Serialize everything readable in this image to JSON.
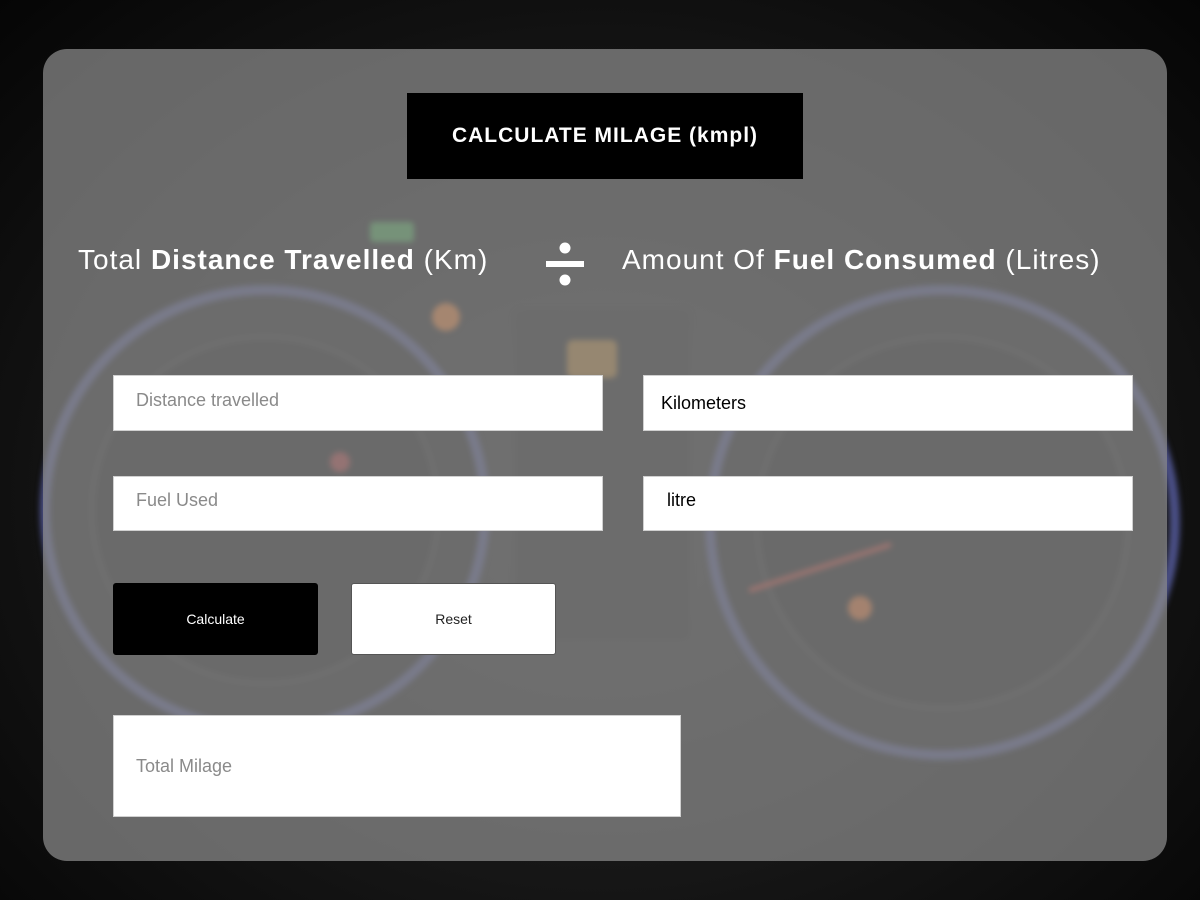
{
  "header": {
    "title": "CALCULATE MILAGE (kmpl)"
  },
  "formula": {
    "left_prefix": "Total ",
    "left_bold": "Distance Travelled",
    "left_suffix": " (Km)",
    "operator_icon": "divide-icon",
    "right_prefix": "Amount Of ",
    "right_bold": "Fuel Consumed",
    "right_suffix": " (Litres)"
  },
  "form": {
    "distance_placeholder": "Distance travelled",
    "distance_value": "",
    "distance_unit": "Kilometers",
    "fuel_placeholder": "Fuel Used",
    "fuel_value": "",
    "fuel_unit": "litre",
    "calculate_label": "Calculate",
    "reset_label": "Reset",
    "total_placeholder": "Total Milage",
    "total_value": ""
  },
  "colors": {
    "card": "#8c8c8c",
    "primary_button": "#000000",
    "secondary_button": "#ffffff",
    "text_light": "#ffffff"
  }
}
